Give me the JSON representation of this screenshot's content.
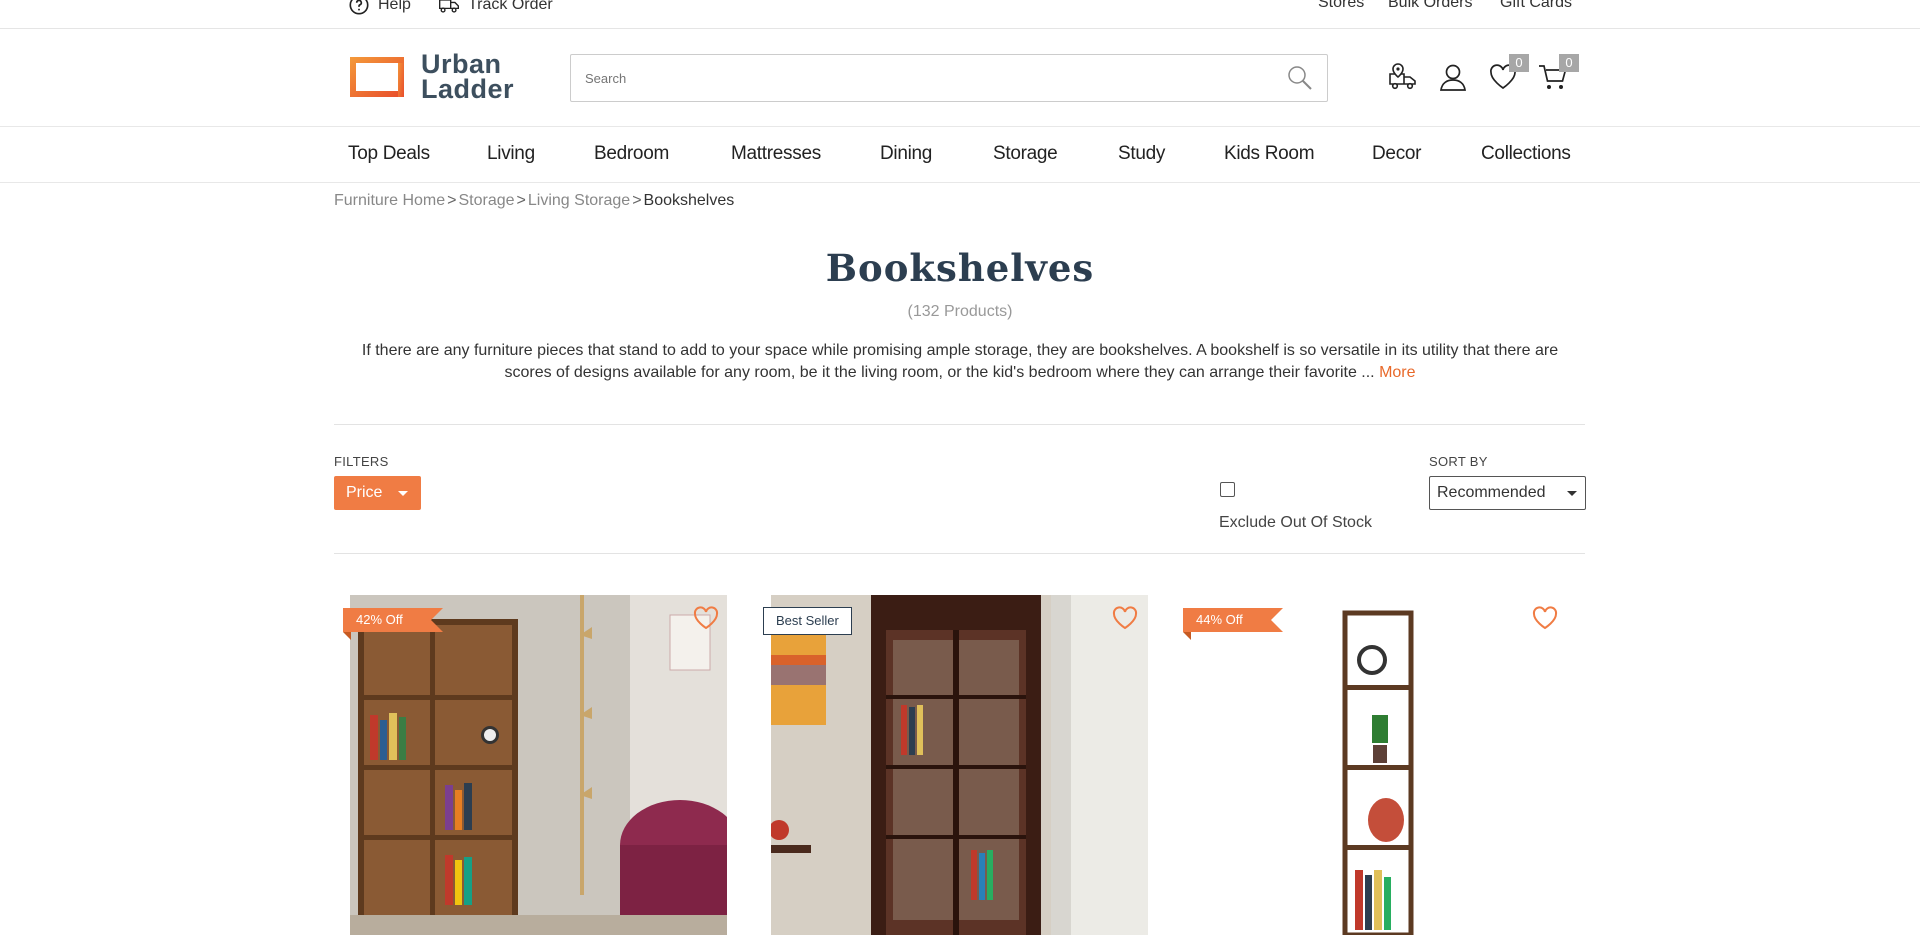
{
  "util_bar": {
    "help": "Help",
    "track_order": "Track Order",
    "stores": "Stores",
    "bulk_orders": "Bulk Orders",
    "gift_cards": "Gift Cards"
  },
  "header": {
    "logo_line1": "Urban",
    "logo_line2": "Ladder",
    "search_placeholder": "Search",
    "wishlist_count": "0",
    "cart_count": "0"
  },
  "nav": {
    "items": [
      "Top Deals",
      "Living",
      "Bedroom",
      "Mattresses",
      "Dining",
      "Storage",
      "Study",
      "Kids Room",
      "Decor",
      "Collections"
    ]
  },
  "breadcrumb": {
    "items": [
      "Furniture Home",
      "Storage",
      "Living Storage"
    ],
    "separator": ">",
    "current": "Bookshelves"
  },
  "page": {
    "title": "Bookshelves",
    "count": "(132 Products)",
    "description": "If there are any furniture pieces that stand to add to your space while promising ample storage, they are bookshelves. A bookshelf is so versatile in its utility that there are scores of designs available for any room, be it the living room, or the kid's bedroom where they can arrange their favorite ...",
    "more": "More"
  },
  "filters": {
    "label": "FILTERS",
    "price": "Price",
    "exclude_out_of_stock": "Exclude Out Of Stock",
    "sort_label": "SORT BY",
    "sort_value": "Recommended"
  },
  "products": [
    {
      "tag": "42% Off",
      "tag_type": "discount"
    },
    {
      "tag": "Best Seller",
      "tag_type": "bestseller"
    },
    {
      "tag": "44% Off",
      "tag_type": "discount"
    }
  ],
  "colors": {
    "accent": "#f07c44",
    "title": "#2c3e50",
    "logo_text": "#3d4f5e"
  }
}
